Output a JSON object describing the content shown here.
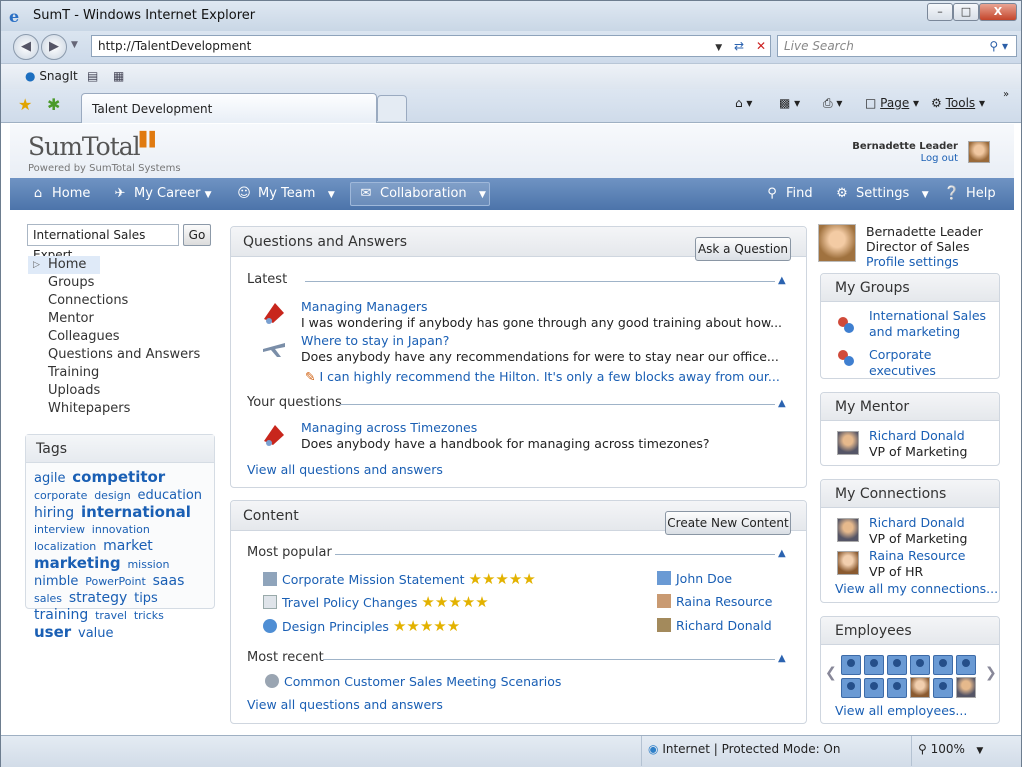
{
  "window": {
    "title": "SumT - Windows Internet Explorer",
    "min": "–",
    "max": "□",
    "close": "X"
  },
  "address": {
    "url": "http://TalentDevelopment",
    "search_placeholder": "Live Search"
  },
  "toolbar": {
    "snagit": "SnagIt"
  },
  "tabs": {
    "active": "Talent Development",
    "page": "Page",
    "tools": "Tools"
  },
  "brand": {
    "logo": "SumTotal",
    "sub": "Powered by SumTotal Systems",
    "user": "Bernadette Leader",
    "logout": "Log out"
  },
  "nav": {
    "home": "Home",
    "career": "My Career",
    "team": "My Team",
    "collab": "Collaboration",
    "find": "Find",
    "settings": "Settings",
    "help": "Help"
  },
  "left": {
    "search_value": "International Sales Expert",
    "go": "Go",
    "items": [
      "Home",
      "Groups",
      "Connections",
      "Mentor",
      "Colleagues",
      "Questions and Answers",
      "Training",
      "Uploads",
      "Whitepapers"
    ],
    "tags_title": "Tags",
    "tags": [
      "agile",
      "competitor",
      "corporate",
      "design",
      "education",
      "hiring",
      "international",
      "interview",
      "innovation",
      "localization",
      "market",
      "marketing",
      "mission",
      "nimble",
      "PowerPoint",
      "saas",
      "sales",
      "strategy",
      "tips",
      "training",
      "travel",
      "tricks",
      "user",
      "value"
    ]
  },
  "qa": {
    "title": "Questions and Answers",
    "ask": "Ask a Question",
    "latest": "Latest",
    "q1_title": "Managing Managers",
    "q1_text": "I was wondering if anybody has gone through any good training about how...",
    "q2_title": "Where to stay in Japan?",
    "q2_text": "Does anybody have any recommendations for were to stay near our office...",
    "q2_reply": "I can highly recommend the Hilton. It's only a few blocks away from our...",
    "yours": "Your questions",
    "q3_title": "Managing across Timezones",
    "q3_text": "Does anybody have a handbook for managing across timezones?",
    "view_all": "View all questions and answers"
  },
  "content": {
    "title": "Content",
    "create": "Create New Content",
    "popular": "Most popular",
    "items": [
      {
        "title": "Corporate Mission Statement",
        "rating": 5,
        "author": "John Doe"
      },
      {
        "title": "Travel Policy Changes",
        "rating": 5,
        "author": "Raina Resource"
      },
      {
        "title": "Design Principles",
        "rating": 5,
        "author": "Richard Donald"
      }
    ],
    "recent": "Most recent",
    "recent_item": "Common Customer Sales Meeting Scenarios",
    "view_all": "View all questions and answers"
  },
  "right": {
    "name": "Bernadette Leader",
    "role": "Director of Sales",
    "profile": "Profile settings",
    "groups_title": "My Groups",
    "group1": "International Sales and marketing",
    "group2": "Corporate executives",
    "mentor_title": "My Mentor",
    "mentor_name": "Richard Donald",
    "mentor_role": "VP of Marketing",
    "conn_title": "My Connections",
    "conn1_name": "Richard Donald",
    "conn1_role": "VP of Marketing",
    "conn2_name": "Raina Resource",
    "conn2_role": "VP of HR",
    "conn_all": "View all my connections...",
    "emp_title": "Employees",
    "emp_all": "View all employees..."
  },
  "status": {
    "zone": "Internet | Protected Mode: On",
    "zoom": "100%"
  },
  "colors": {
    "nav": "#5a7fb5",
    "link": "#1a5fb4",
    "star": "#e3b200"
  }
}
